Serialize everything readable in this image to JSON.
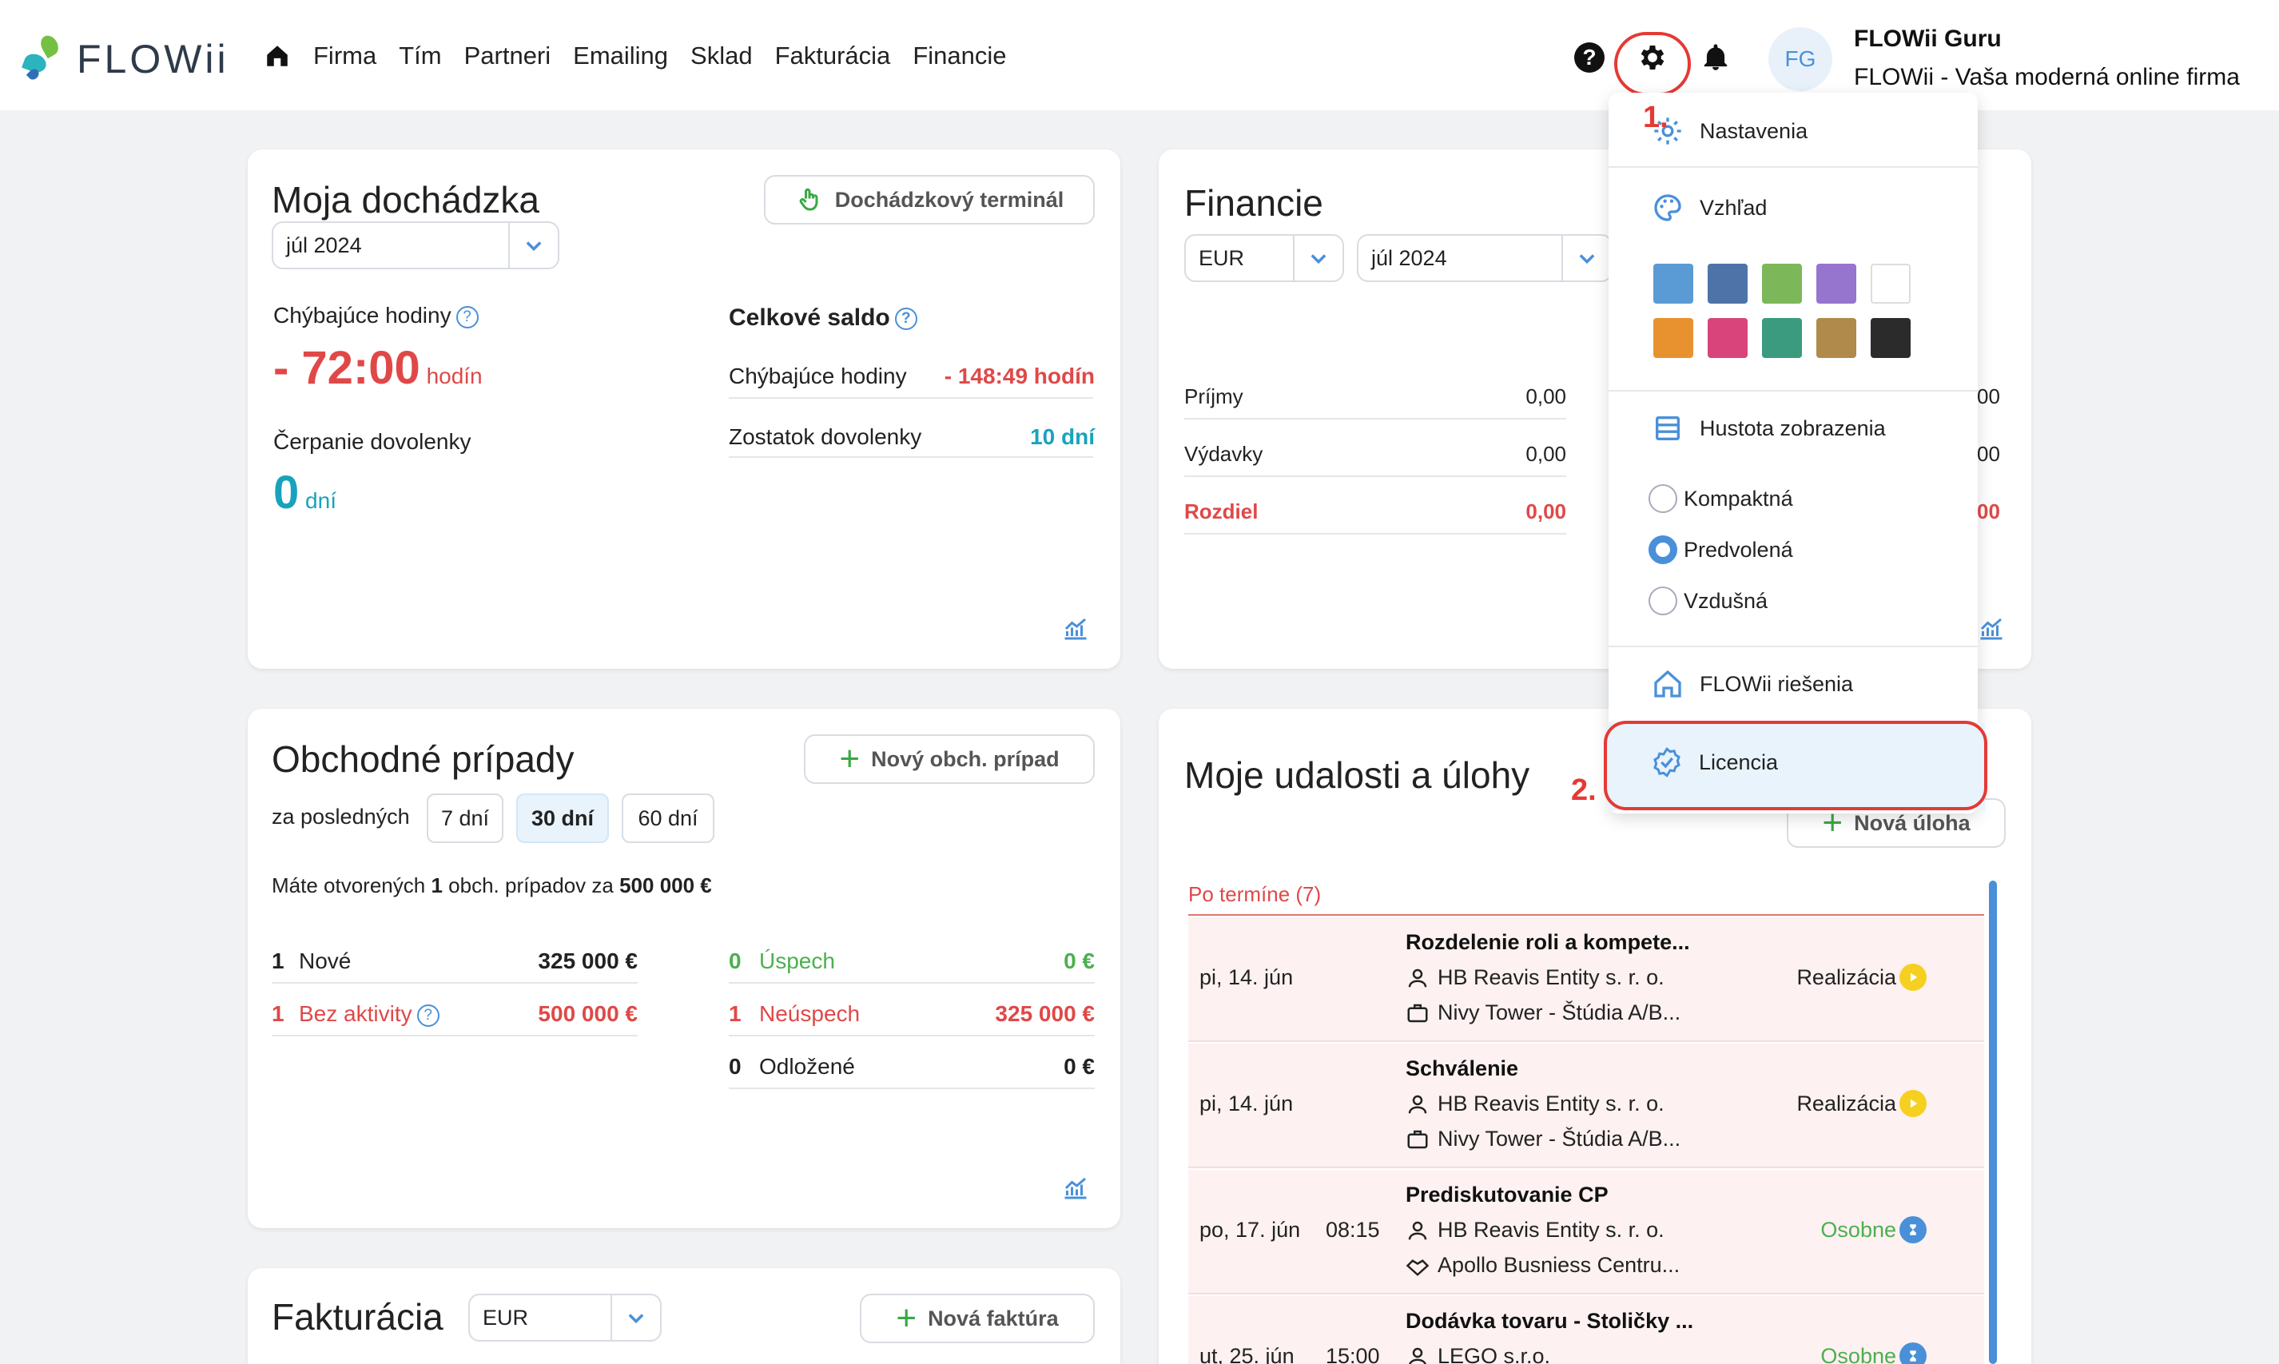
{
  "brand": {
    "name": "FLOWii"
  },
  "nav": {
    "items": [
      "Firma",
      "Tím",
      "Partneri",
      "Emailing",
      "Sklad",
      "Fakturácia",
      "Financie"
    ]
  },
  "user": {
    "initials": "FG",
    "name": "FLOWii Guru",
    "company": "FLOWii - Vaša moderná online firma"
  },
  "annotations": {
    "step1": "1.",
    "step2": "2."
  },
  "attendance": {
    "title": "Moja dochádzka",
    "terminal_button": "Dochádzkový terminál",
    "month": "júl 2024",
    "missing_label": "Chýbajúce hodiny",
    "missing_value": "- 72:00",
    "missing_unit": "hodín",
    "vacation_label": "Čerpanie dovolenky",
    "vacation_value": "0",
    "vacation_unit": "dní",
    "total_title": "Celkové saldo",
    "total_missing_label": "Chýbajúce hodiny",
    "total_missing_value": "- 148:49 hodín",
    "remaining_label": "Zostatok dovolenky",
    "remaining_value": "10 dní"
  },
  "finance": {
    "title": "Financie",
    "currency": "EUR",
    "month": "júl 2024",
    "rows": [
      {
        "label": "Príjmy",
        "value": "0,00",
        "right": "00"
      },
      {
        "label": "Výdavky",
        "value": "0,00",
        "right": "00"
      },
      {
        "label": "Rozdiel",
        "value": "0,00",
        "right": "00"
      }
    ]
  },
  "deals": {
    "title": "Obchodné prípady",
    "new_button": "Nový obch. prípad",
    "period_label": "za posledných",
    "periods": [
      "7 dní",
      "30 dní",
      "60 dní"
    ],
    "summary_prefix": "Máte otvorených",
    "summary_count": "1",
    "summary_mid": "obch. prípadov za",
    "summary_amount": "500 000 €",
    "left": [
      {
        "count": "1",
        "label": "Nové",
        "amount": "325 000 €"
      },
      {
        "count": "1",
        "label": "Bez aktivity",
        "amount": "500 000 €"
      }
    ],
    "right": [
      {
        "count": "0",
        "label": "Úspech",
        "amount": "0 €"
      },
      {
        "count": "1",
        "label": "Neúspech",
        "amount": "325 000 €"
      },
      {
        "count": "0",
        "label": "Odložené",
        "amount": "0 €"
      }
    ]
  },
  "invoicing": {
    "title": "Fakturácia",
    "currency": "EUR",
    "new_button": "Nová faktúra"
  },
  "tasks": {
    "title": "Moje udalosti a úlohy",
    "new_button": "Nová úloha",
    "overdue": "Po termíne (7)",
    "rows": [
      {
        "date": "pi, 14. jún",
        "time": "",
        "title": "Rozdelenie roli a kompete...",
        "company": "HB Reavis Entity s. r. o.",
        "project": "Nivy Tower - Štúdia A/B...",
        "status": "Realizácia"
      },
      {
        "date": "pi, 14. jún",
        "time": "",
        "title": "Schválenie",
        "company": "HB Reavis Entity s. r. o.",
        "project": "Nivy Tower - Štúdia A/B...",
        "status": "Realizácia"
      },
      {
        "date": "po, 17. jún",
        "time": "08:15",
        "title": "Prediskutovanie CP",
        "company": "HB Reavis Entity s. r. o.",
        "project": "Apollo Busniess Centru...",
        "status": "Osobne"
      },
      {
        "date": "ut, 25. jún",
        "time": "15:00",
        "title": "Dodávka tovaru - Stoličky ...",
        "company": "LEGO s.r.o.",
        "project": "",
        "status": "Osobne"
      }
    ]
  },
  "settings_menu": {
    "settings": "Nastavenia",
    "appearance": "Vzhľad",
    "swatches": [
      "#5b9bd5",
      "#4e73a8",
      "#7cb85a",
      "#9575cd",
      "#ffffff",
      "#e8922f",
      "#d9447a",
      "#3a9b7e",
      "#b08a4a",
      "#2b2b2b"
    ],
    "density": "Hustota zobrazenia",
    "density_options": [
      "Kompaktná",
      "Predvolená",
      "Vzdušná"
    ],
    "density_selected": "Predvolená",
    "solutions": "FLOWii riešenia",
    "license": "Licencia"
  }
}
